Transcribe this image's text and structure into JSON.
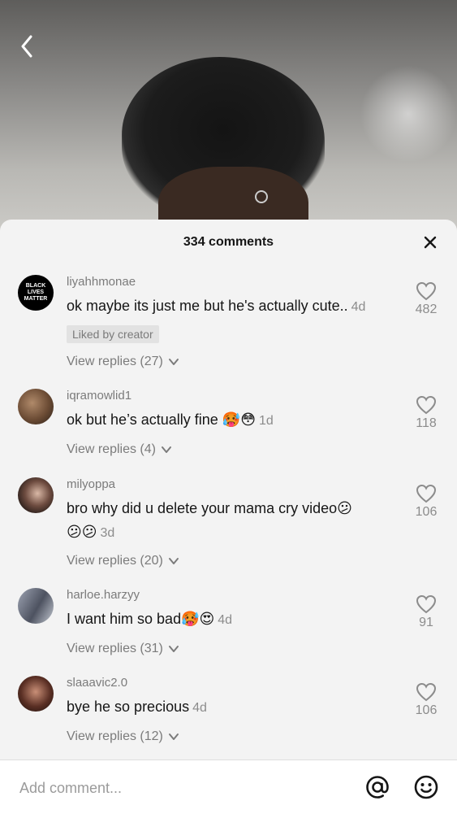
{
  "header": {
    "title": "334 comments"
  },
  "comments": [
    {
      "username": "liyahhmonae",
      "text": "ok maybe its just me but he's actually cute..",
      "emojis": "",
      "time": "4d",
      "badge": "Liked by creator",
      "replies": "View replies (27)",
      "likes": "482",
      "avatar_text": [
        "BLACK",
        "LIVES",
        "MATTER"
      ]
    },
    {
      "username": "iqramowlid1",
      "text": "ok but he’s actually fine",
      "emojis": "🥵😳",
      "time": "1d",
      "replies": "View replies (4)",
      "likes": "118"
    },
    {
      "username": "milyoppa",
      "text": "bro why did u delete your mama cry video",
      "emojis": "😕",
      "emojis2": "😕😕",
      "time": "3d",
      "replies": "View replies (20)",
      "likes": "106"
    },
    {
      "username": "harloe.harzyy",
      "text": "I want him so bad",
      "emojis": "🥵😍",
      "time": "4d",
      "replies": "View replies (31)",
      "likes": "91"
    },
    {
      "username": "slaaavic2.0",
      "text": "bye he so precious",
      "emojis": "",
      "time": "4d",
      "replies": "View replies (12)",
      "likes": "106"
    }
  ],
  "bottom_bar": {
    "placeholder": "Add comment..."
  },
  "icons": {
    "back": "chevron-left-icon",
    "close": "close-icon",
    "like": "heart-icon",
    "replies": "chevron-down-icon",
    "mention": "at-sign-icon",
    "emoji": "smiley-icon"
  }
}
